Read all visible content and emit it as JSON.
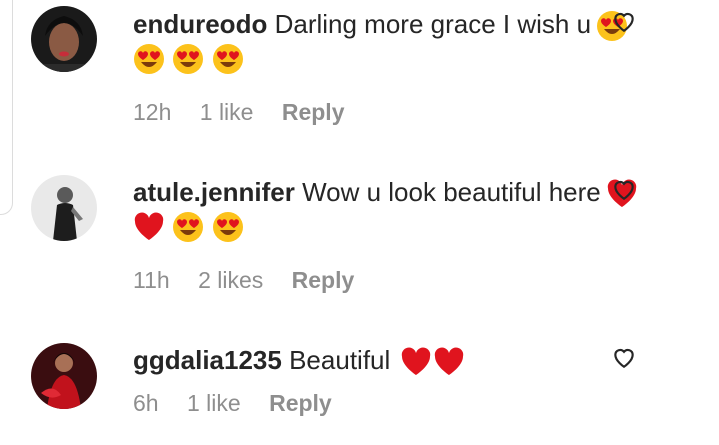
{
  "comments": [
    {
      "username": "endureodo",
      "text": "Darling more grace I wish u",
      "time": "12h",
      "likes": "1 like",
      "reply": "Reply",
      "inline_emoji": [
        "heart-eyes"
      ],
      "emoji_line": [
        "heart-eyes",
        "heart-eyes",
        "heart-eyes"
      ]
    },
    {
      "username": "atule.jennifer",
      "text": "Wow u look beautiful here",
      "time": "11h",
      "likes": "2 likes",
      "reply": "Reply",
      "inline_emoji": [
        "red-heart"
      ],
      "emoji_line": [
        "red-heart",
        "heart-eyes",
        "heart-eyes"
      ]
    },
    {
      "username": "ggdalia1235",
      "text": "Beautiful",
      "time": "6h",
      "likes": "1 like",
      "reply": "Reply",
      "inline_emoji": [
        "red-heart",
        "red-heart"
      ],
      "emoji_line": []
    }
  ],
  "colors": {
    "text": "#262626",
    "secondary": "#8e8e8e",
    "heart_red": "#e0141e",
    "emoji_yellow": "#fcc21b"
  },
  "icons": {
    "like_button": "heart-outline-icon",
    "heart_eyes": "heart-eyes-emoji",
    "red_heart": "red-heart-emoji"
  }
}
